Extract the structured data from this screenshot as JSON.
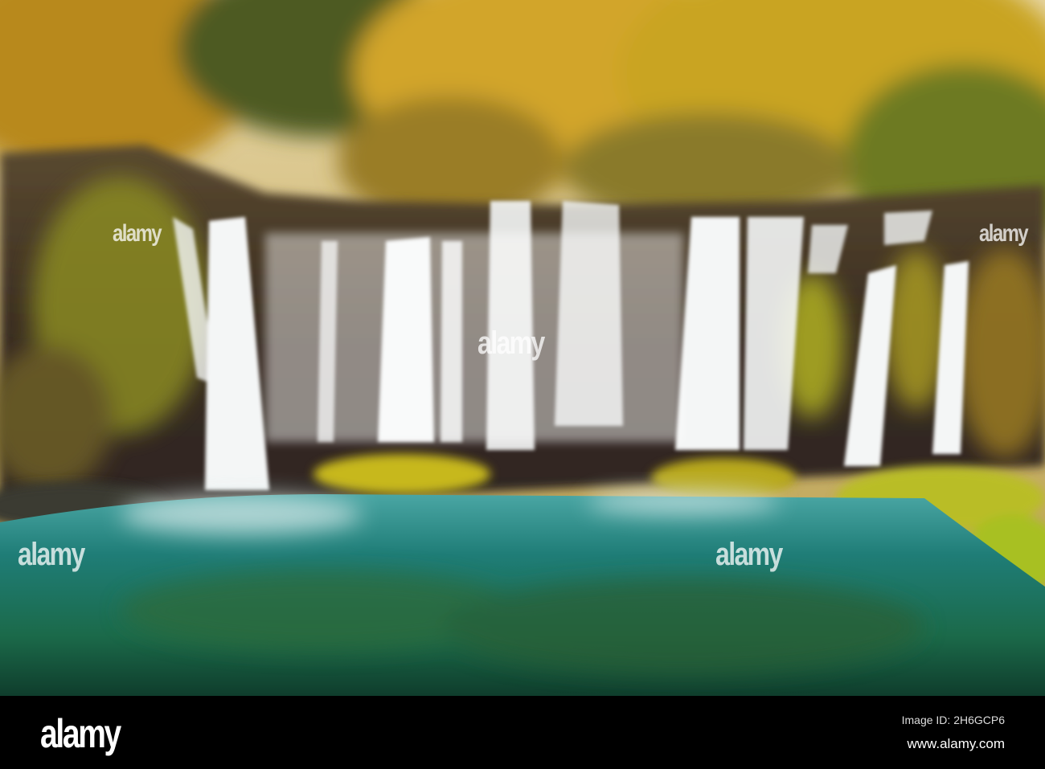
{
  "photo": {
    "subject": "waterfall-in-autumn-forest"
  },
  "watermark": {
    "text": "alamy"
  },
  "footer": {
    "logo": "alamy",
    "image_id": "Image ID: 2H6GCP6",
    "website": "www.alamy.com"
  }
}
